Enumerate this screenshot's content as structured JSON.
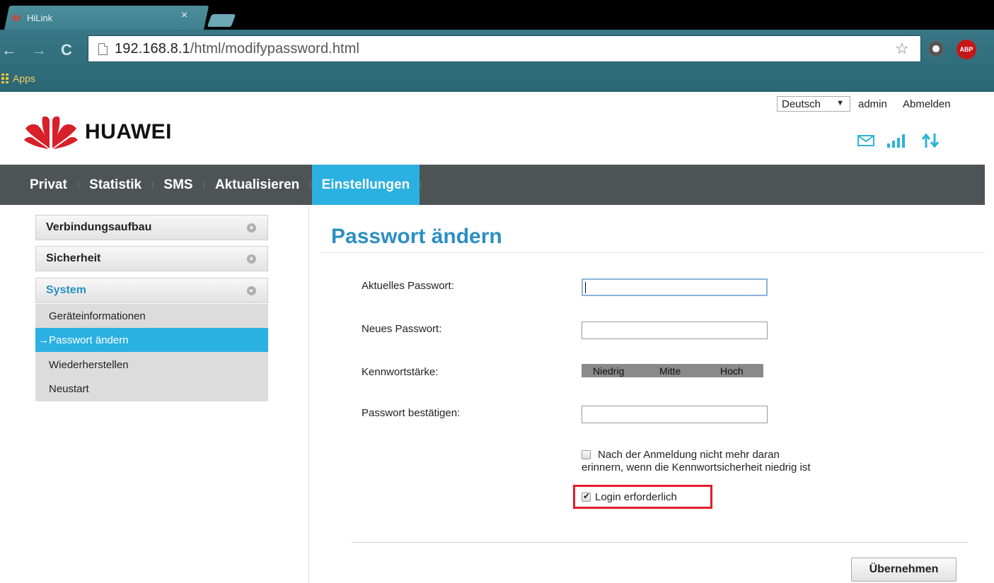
{
  "browser": {
    "tab_title": "HiLink",
    "tab_close": "×",
    "url_host": "192.168.8.1",
    "url_path": "/html/modifypassword.html",
    "bookmarks_apps": "Apps",
    "abp_label": "ABP"
  },
  "header": {
    "language": "Deutsch",
    "language_arrow": "▼",
    "user": "admin",
    "logout": "Abmelden",
    "brand": "HUAWEI"
  },
  "nav": {
    "items": [
      {
        "label": "Privat"
      },
      {
        "label": "Statistik"
      },
      {
        "label": "SMS"
      },
      {
        "label": "Aktualisieren"
      },
      {
        "label": "Einstellungen",
        "active": true
      }
    ]
  },
  "sidebar": {
    "groups": [
      {
        "label": "Verbindungsaufbau"
      },
      {
        "label": "Sicherheit"
      },
      {
        "label": "System",
        "open": true
      }
    ],
    "sub_items": [
      {
        "label": "Geräteinformationen"
      },
      {
        "label": "→Passwort ändern",
        "active": true
      },
      {
        "label": "Wiederherstellen"
      },
      {
        "label": "Neustart"
      }
    ]
  },
  "form": {
    "title": "Passwort ändern",
    "current_password_label": "Aktuelles Passwort:",
    "current_password_value": "",
    "new_password_label": "Neues Passwort:",
    "new_password_value": "",
    "strength_label": "Kennwortstärke:",
    "strength_levels": [
      "Niedrig",
      "Mitte",
      "Hoch"
    ],
    "confirm_label": "Passwort bestätigen:",
    "confirm_value": "",
    "reminder_checkbox_line1": "Nach der Anmeldung nicht mehr daran",
    "reminder_checkbox_rest": "erinnern, wenn die Kennwortsicherheit niedrig ist",
    "reminder_checked": false,
    "login_required_label": "Login erforderlich",
    "login_required_checked": true,
    "apply_button": "Übernehmen"
  },
  "colors": {
    "accent": "#2bb0e2",
    "nav_bg": "#4e5456",
    "title": "#2b8fc2",
    "highlight_border": "#e01f2a",
    "brand_red": "#d8202a"
  }
}
